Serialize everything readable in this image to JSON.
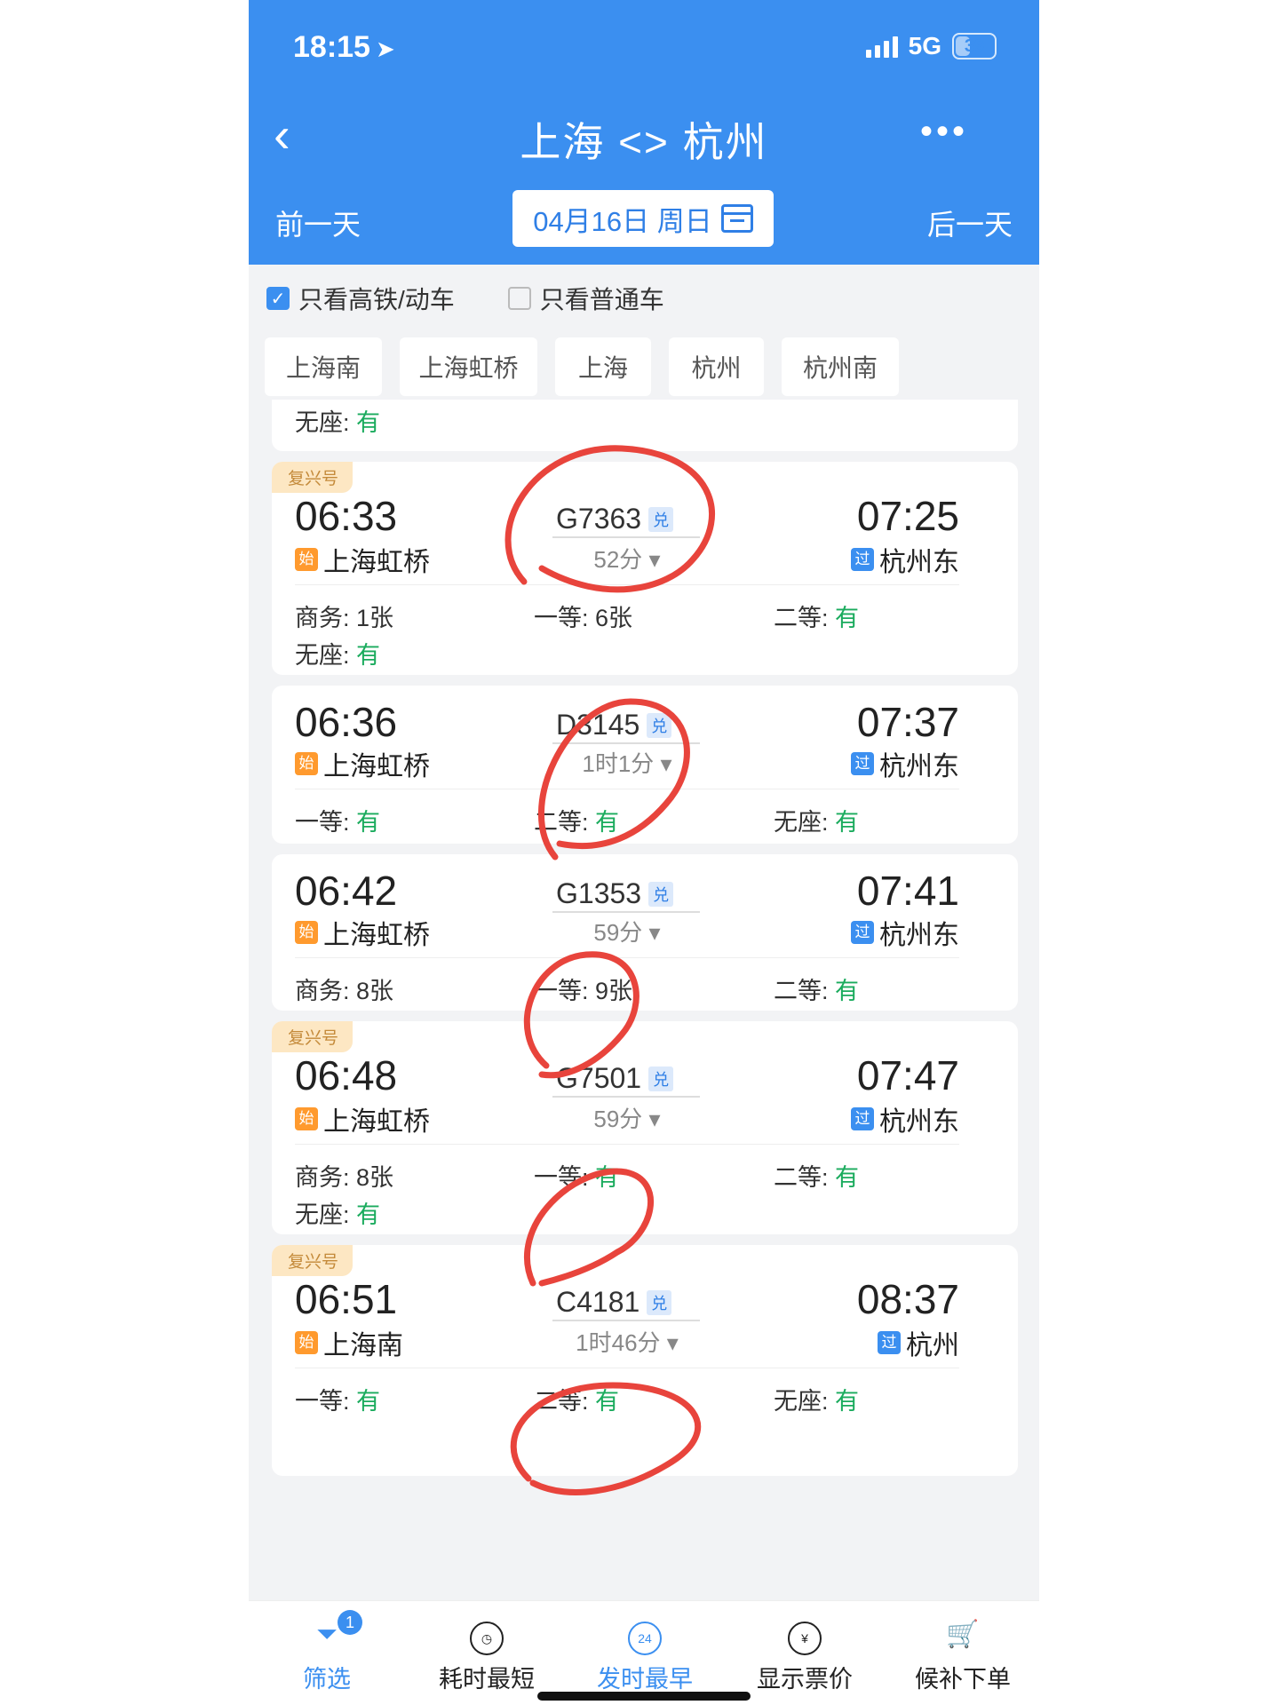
{
  "status": {
    "time": "18:15",
    "network": "5G",
    "battery": "39",
    "battery_level": 0.39
  },
  "header": {
    "title": "上海 <> 杭州",
    "back_icon": "chevron-left-icon",
    "more_icon": "more-dots-icon",
    "prev_day": "前一天",
    "next_day": "后一天",
    "date": "04月16日 周日"
  },
  "filters": {
    "high_speed": "只看高铁/动车",
    "high_speed_checked": true,
    "normal": "只看普通车",
    "normal_checked": false
  },
  "stations": [
    "上海南",
    "上海虹桥",
    "上海",
    "杭州",
    "杭州南"
  ],
  "partial": {
    "seat_label": "无座:",
    "seat_value": "有"
  },
  "trains": [
    {
      "brand": "复兴号",
      "dep_time": "06:33",
      "dep_station": "上海虹桥",
      "dep_badge": "始",
      "train_no": "G7363",
      "exchange": "兑",
      "duration": "52分",
      "arr_time": "07:25",
      "arr_station": "杭州东",
      "arr_badge": "过",
      "seats_row1": [
        {
          "label": "商务:",
          "value": "1张",
          "green": false
        },
        {
          "label": "一等:",
          "value": "6张",
          "green": false
        },
        {
          "label": "二等:",
          "value": "有",
          "green": true
        }
      ],
      "seats_row2": [
        {
          "label": "无座:",
          "value": "有",
          "green": true
        }
      ]
    },
    {
      "brand": "",
      "dep_time": "06:36",
      "dep_station": "上海虹桥",
      "dep_badge": "始",
      "train_no": "D3145",
      "exchange": "兑",
      "duration": "1时1分",
      "arr_time": "07:37",
      "arr_station": "杭州东",
      "arr_badge": "过",
      "seats_row1": [
        {
          "label": "一等:",
          "value": "有",
          "green": true
        },
        {
          "label": "二等:",
          "value": "有",
          "green": true
        },
        {
          "label": "无座:",
          "value": "有",
          "green": true
        }
      ],
      "seats_row2": []
    },
    {
      "brand": "",
      "dep_time": "06:42",
      "dep_station": "上海虹桥",
      "dep_badge": "始",
      "train_no": "G1353",
      "exchange": "兑",
      "duration": "59分",
      "arr_time": "07:41",
      "arr_station": "杭州东",
      "arr_badge": "过",
      "seats_row1": [
        {
          "label": "商务:",
          "value": "8张",
          "green": false
        },
        {
          "label": "一等:",
          "value": "9张",
          "green": false
        },
        {
          "label": "二等:",
          "value": "有",
          "green": true
        }
      ],
      "seats_row2": []
    },
    {
      "brand": "复兴号",
      "dep_time": "06:48",
      "dep_station": "上海虹桥",
      "dep_badge": "始",
      "train_no": "G7501",
      "exchange": "兑",
      "duration": "59分",
      "arr_time": "07:47",
      "arr_station": "杭州东",
      "arr_badge": "过",
      "seats_row1": [
        {
          "label": "商务:",
          "value": "8张",
          "green": false
        },
        {
          "label": "一等:",
          "value": "有",
          "green": true
        },
        {
          "label": "二等:",
          "value": "有",
          "green": true
        }
      ],
      "seats_row2": [
        {
          "label": "无座:",
          "value": "有",
          "green": true
        }
      ]
    },
    {
      "brand": "复兴号",
      "dep_time": "06:51",
      "dep_station": "上海南",
      "dep_badge": "始",
      "train_no": "C4181",
      "exchange": "兑",
      "duration": "1时46分",
      "arr_time": "08:37",
      "arr_station": "杭州",
      "arr_badge": "过",
      "seats_row1": [
        {
          "label": "一等:",
          "value": "有",
          "green": true
        },
        {
          "label": "二等:",
          "value": "有",
          "green": true
        },
        {
          "label": "无座:",
          "value": "有",
          "green": true
        }
      ],
      "seats_row2": []
    }
  ],
  "tabbar": [
    {
      "label": "筛选",
      "icon": "funnel-icon",
      "active": true,
      "badge": "1"
    },
    {
      "label": "耗时最短",
      "icon": "timer-icon",
      "active": false
    },
    {
      "label": "发时最早",
      "icon": "clock-24-icon",
      "active": true
    },
    {
      "label": "显示票价",
      "icon": "yen-icon",
      "active": false
    },
    {
      "label": "候补下单",
      "icon": "cart-plus-icon",
      "active": false
    }
  ],
  "colors": {
    "accent": "#3b8ff0",
    "available_green": "#1aab5d",
    "annotation_red": "#e8443c"
  }
}
